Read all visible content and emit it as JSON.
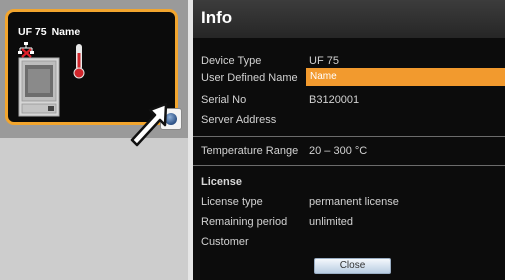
{
  "device_tile": {
    "model": "UF 75",
    "name": "Name",
    "icons": {
      "network": "network-disconnected-icon",
      "thermometer": "thermometer-icon",
      "device": "oven-device-icon",
      "info_button": "info-button-icon",
      "cursor": "pointer-arrow-icon"
    }
  },
  "info": {
    "title": "Info",
    "device_type": {
      "label": "Device Type",
      "value": "UF 75"
    },
    "user_defined_name": {
      "label": "User Defined Name",
      "value": "Name"
    },
    "serial_no": {
      "label": "Serial No",
      "value": "B3120001"
    },
    "server_address": {
      "label": "Server Address",
      "value": ""
    },
    "temperature_range": {
      "label": "Temperature Range",
      "value": "20 – 300 °C"
    },
    "license": {
      "heading": "License",
      "license_type": {
        "label": "License type",
        "value": "permanent license"
      },
      "remaining_period": {
        "label": "Remaining period",
        "value": "unlimited"
      },
      "customer": {
        "label": "Customer",
        "value": ""
      }
    },
    "close_label": "Close"
  },
  "colors": {
    "accent_orange": "#f29a2e",
    "tile_border": "#f2a52e",
    "panel_background": "#0c0c0c",
    "left_background": "#9a9a9a"
  }
}
